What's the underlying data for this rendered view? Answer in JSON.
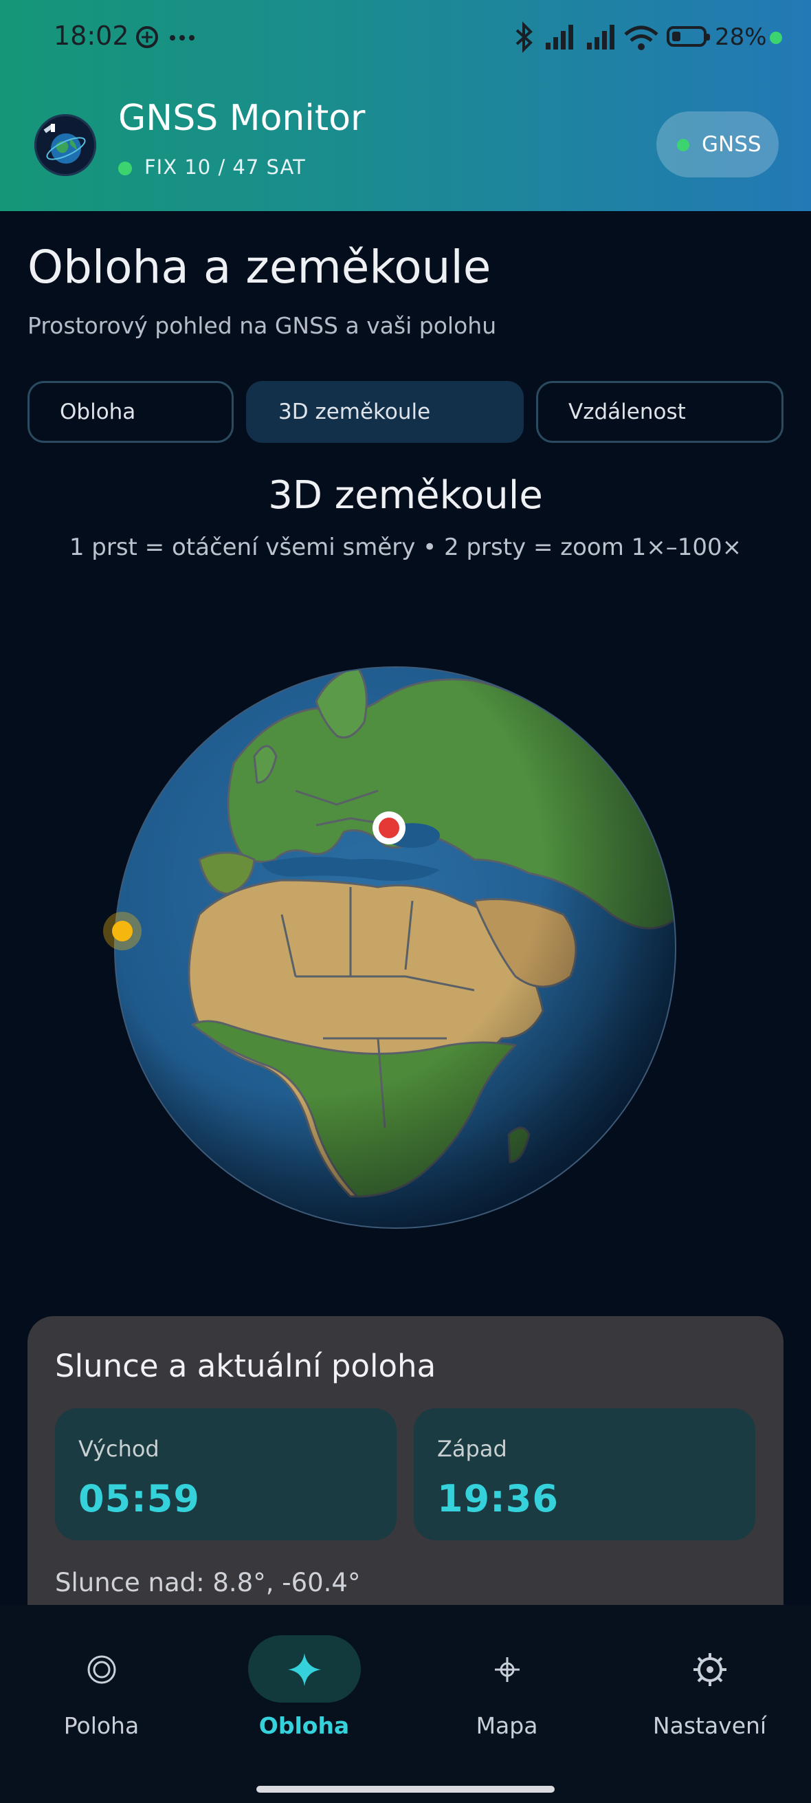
{
  "status_bar": {
    "time": "18:02",
    "battery": "28%"
  },
  "header": {
    "app_title": "GNSS Monitor",
    "fix_text": "FIX 10 / 47 SAT",
    "gnss_button": "GNSS"
  },
  "page": {
    "title": "Obloha a zeměkoule",
    "subtitle": "Prostorový pohled na GNSS a vaši polohu"
  },
  "tabs": [
    {
      "label": "Obloha",
      "active": false
    },
    {
      "label": "3D zeměkoule",
      "active": true
    },
    {
      "label": "Vzdálenost",
      "active": false
    }
  ],
  "globe": {
    "title": "3D zeměkoule",
    "hint": "1 prst = otáčení všemi směry  •  2 prsty = zoom 1×–100×"
  },
  "sun_card": {
    "title": "Slunce a aktuální poloha",
    "sunrise_label": "Východ",
    "sunrise_value": "05:59",
    "sunset_label": "Západ",
    "sunset_value": "19:36",
    "sun_position": "Slunce nad: 8.8°, -60.4°"
  },
  "bottom_nav": [
    {
      "label": "Poloha",
      "icon": "target-icon",
      "active": false
    },
    {
      "label": "Obloha",
      "icon": "sparkle-icon",
      "active": true
    },
    {
      "label": "Mapa",
      "icon": "crosshair-icon",
      "active": false
    },
    {
      "label": "Nastavení",
      "icon": "gear-icon",
      "active": false
    }
  ],
  "colors": {
    "accent": "#36d2dc",
    "background": "#040d1b",
    "fix_green": "#3bd46e",
    "location_marker": "#e53935",
    "sun_marker": "#f5b60d"
  }
}
